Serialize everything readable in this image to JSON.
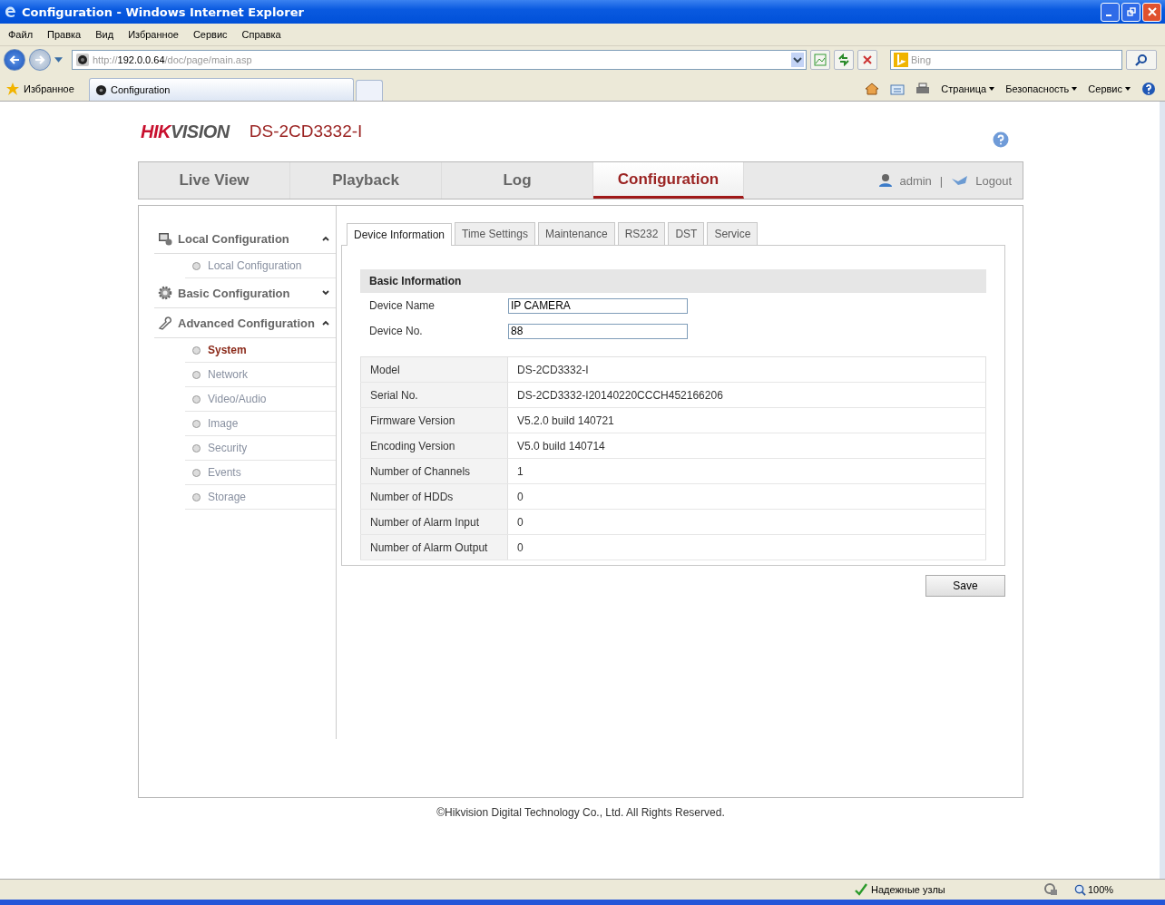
{
  "window": {
    "title": "Configuration - Windows Internet Explorer"
  },
  "menu": [
    "Файл",
    "Правка",
    "Вид",
    "Избранное",
    "Сервис",
    "Справка"
  ],
  "address": {
    "scheme": "http://",
    "host": "192.0.0.64",
    "path": "/doc/page/main.asp"
  },
  "search": {
    "placeholder": "Bing"
  },
  "favorites": "Избранное",
  "browser_tabs": [
    {
      "label": "Configuration",
      "selected": true
    }
  ],
  "command_bar": [
    "Страница",
    "Безопасность",
    "Сервис"
  ],
  "header": {
    "logo_primary": "HIK",
    "logo_secondary": "VISION",
    "model": "DS-2CD3332-I"
  },
  "nav": [
    {
      "label": "Live View",
      "selected": false
    },
    {
      "label": "Playback",
      "selected": false
    },
    {
      "label": "Log",
      "selected": false
    },
    {
      "label": "Configuration",
      "selected": true
    }
  ],
  "user": {
    "name": "admin",
    "separator": "|",
    "logout": "Logout"
  },
  "sidebar": [
    {
      "title": "Local Configuration",
      "kind": "monitor",
      "expanded": true,
      "children": [
        {
          "label": "Local Configuration",
          "selected": false
        }
      ]
    },
    {
      "title": "Basic Configuration",
      "kind": "gear",
      "expanded": false
    },
    {
      "title": "Advanced Configuration",
      "kind": "wrench",
      "expanded": true,
      "children": [
        {
          "label": "System",
          "selected": true
        },
        {
          "label": "Network",
          "selected": false
        },
        {
          "label": "Video/Audio",
          "selected": false
        },
        {
          "label": "Image",
          "selected": false
        },
        {
          "label": "Security",
          "selected": false
        },
        {
          "label": "Events",
          "selected": false
        },
        {
          "label": "Storage",
          "selected": false
        }
      ]
    }
  ],
  "tabs": [
    {
      "label": "Device Information",
      "selected": true
    },
    {
      "label": "Time Settings",
      "selected": false
    },
    {
      "label": "Maintenance",
      "selected": false
    },
    {
      "label": "RS232",
      "selected": false
    },
    {
      "label": "DST",
      "selected": false
    },
    {
      "label": "Service",
      "selected": false
    }
  ],
  "section_title": "Basic Information",
  "fields": [
    {
      "label": "Device Name",
      "value": "IP CAMERA"
    },
    {
      "label": "Device No.",
      "value": "88"
    }
  ],
  "info": [
    {
      "label": "Model",
      "value": "DS-2CD3332-I"
    },
    {
      "label": "Serial No.",
      "value": "DS-2CD3332-I20140220CCCH452166206"
    },
    {
      "label": "Firmware Version",
      "value": "V5.2.0 build 140721"
    },
    {
      "label": "Encoding Version",
      "value": "V5.0 build 140714"
    },
    {
      "label": "Number of Channels",
      "value": "1"
    },
    {
      "label": "Number of HDDs",
      "value": "0"
    },
    {
      "label": "Number of Alarm Input",
      "value": "0"
    },
    {
      "label": "Number of Alarm Output",
      "value": "0"
    }
  ],
  "save": "Save",
  "footer": "©Hikvision Digital Technology Co., Ltd. All Rights Reserved.",
  "status_bar": {
    "zone": "Надежные узлы",
    "zoom": "100%"
  }
}
